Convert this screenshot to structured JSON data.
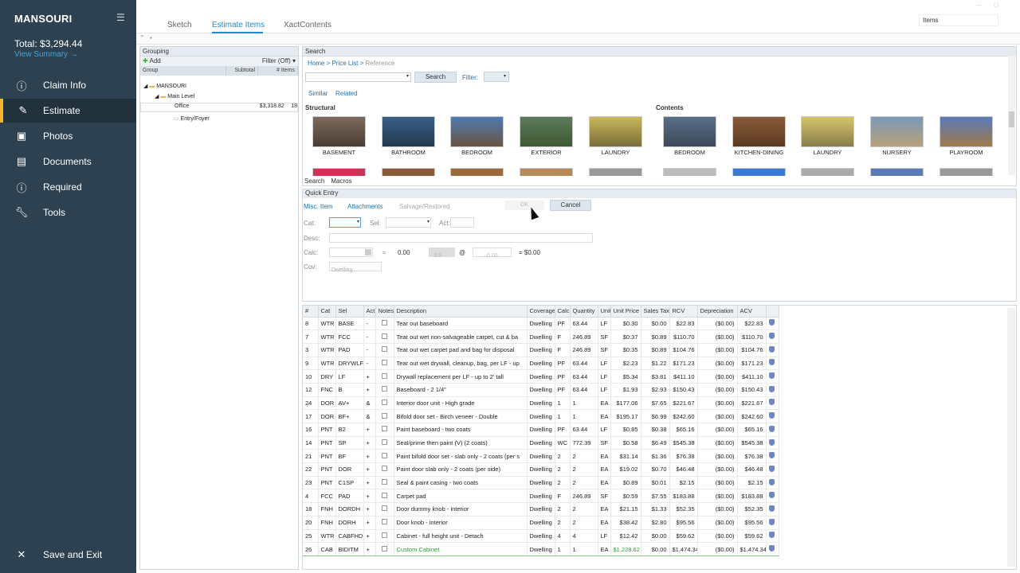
{
  "sidebar": {
    "project": "MANSOURI",
    "total": "Total: $3,294.44",
    "view_summary": "View Summary →",
    "items": [
      {
        "label": "Claim Info",
        "icon": "info-icon"
      },
      {
        "label": "Estimate",
        "icon": "pencil-icon"
      },
      {
        "label": "Photos",
        "icon": "photo-icon"
      },
      {
        "label": "Documents",
        "icon": "document-icon"
      },
      {
        "label": "Required",
        "icon": "info-icon"
      },
      {
        "label": "Tools",
        "icon": "wrench-icon"
      }
    ],
    "save_exit": "Save and Exit"
  },
  "tabs": [
    "Sketch",
    "Estimate Items",
    "XactContents"
  ],
  "items_dropdown": "Items",
  "grouping": {
    "title": "Grouping",
    "add": "Add",
    "filter": "Filter (Off)",
    "columns": [
      "Group",
      "Subtotal",
      "# Items"
    ],
    "tree": {
      "root": "MANSOURI",
      "level": "Main Level",
      "office": "Office",
      "office_subtotal": "$3,318.82",
      "office_count": "18",
      "entry": "Entry/Foyer"
    }
  },
  "search": {
    "title": "Search",
    "crumbs": [
      "Home",
      "Price List",
      "Reference"
    ],
    "button": "Search",
    "filter_label": "Filter:",
    "similar": "Similar",
    "related": "Related",
    "structural_label": "Structural",
    "contents_label": "Contents",
    "structural": [
      "BASEMENT",
      "BATHROOM",
      "BEDROOM",
      "EXTERIOR",
      "LAUNDRY"
    ],
    "contents": [
      "BEDROOM",
      "KITCHEN-DINING",
      "LAUNDRY",
      "NURSERY",
      "PLAYROOM"
    ],
    "bottom_tabs": [
      "Search",
      "Macros"
    ]
  },
  "quick_entry": {
    "title": "Quick Entry",
    "misc": "Misc. Item",
    "attachments": "Attachments",
    "salvage": "Salvage/Restored",
    "ok": "OK",
    "cancel": "Cancel",
    "cat": "Cat:",
    "sel": "Sel:",
    "act": "Act:",
    "desc": "Desc:",
    "calc": "Calc:",
    "eq": "=",
    "qty": "0.00",
    "unit": "EA",
    "at": "@",
    "price": "0.00",
    "total": "= $0.00",
    "cov": "Cov:",
    "cov_value": "Dwelling"
  },
  "grid": {
    "columns": [
      "#",
      "Cat",
      "Sel",
      "Act",
      "Notes",
      "Description",
      "Coverage",
      "Calc",
      "Quantity",
      "Unit",
      "Unit Price",
      "Sales Tax",
      "RCV",
      "Depreciation",
      "ACV"
    ],
    "rows": [
      [
        "8",
        "WTR",
        "BASE",
        "-",
        "Tear out baseboard",
        "Dwelling",
        "PF",
        "63.44",
        "LF",
        "$0.30",
        "$0.00",
        "$22.83",
        "($0.00)",
        "$22.83"
      ],
      [
        "7",
        "WTR",
        "FCC",
        "-",
        "Tear out wet non-salvageable carpet, cut & ba",
        "Dwelling",
        "F",
        "246.89",
        "SF",
        "$0.37",
        "$0.89",
        "$110.70",
        "($0.00)",
        "$110.70"
      ],
      [
        "3",
        "WTR",
        "PAD",
        "-",
        "Tear out wet carpet pad and bag for disposal",
        "Dwelling",
        "F",
        "246.89",
        "SF",
        "$0.35",
        "$0.89",
        "$104.76",
        "($0.00)",
        "$104.76"
      ],
      [
        "9",
        "WTR",
        "DRYWLF",
        "-",
        "Tear out wet drywall, cleanup, bag, per LF - up",
        "Dwelling",
        "PF",
        "63.44",
        "LF",
        "$2.23",
        "$1.22",
        "$171.23",
        "($0.00)",
        "$171.23"
      ],
      [
        "10",
        "DRY",
        "LF",
        "+",
        "Drywall replacement per LF - up to 2' tall",
        "Dwelling",
        "PF",
        "63.44",
        "LF",
        "$5.34",
        "$3.81",
        "$411.10",
        "($0.00)",
        "$411.10"
      ],
      [
        "12",
        "FNC",
        "B",
        "+",
        "Baseboard - 2 1/4\"",
        "Dwelling",
        "PF",
        "63.44",
        "LF",
        "$1.93",
        "$2.93",
        "$150.43",
        "($0.00)",
        "$150.43"
      ],
      [
        "24",
        "DOR",
        "AV+",
        "&",
        "Interior door unit - High grade",
        "Dwelling",
        "1",
        "1",
        "EA",
        "$177.06",
        "$7.65",
        "$221.67",
        "($0.00)",
        "$221.67"
      ],
      [
        "17",
        "DOR",
        "BF+",
        "&",
        "Bifold door set - Birch veneer - Double",
        "Dwelling",
        "1",
        "1",
        "EA",
        "$195.17",
        "$6.99",
        "$242.60",
        "($0.00)",
        "$242.60"
      ],
      [
        "16",
        "PNT",
        "B2",
        "+",
        "Paint baseboard - two coats",
        "Dwelling",
        "PF",
        "63.44",
        "LF",
        "$0.85",
        "$0.38",
        "$65.16",
        "($0.00)",
        "$65.16"
      ],
      [
        "14",
        "PNT",
        "SP",
        "+",
        "Seal/prime then paint (V) (2 coats)",
        "Dwelling",
        "WC",
        "772.39",
        "SF",
        "$0.58",
        "$6.49",
        "$545.38",
        "($0.00)",
        "$545.38"
      ],
      [
        "21",
        "PNT",
        "BF",
        "+",
        "Paint bifold door set - slab only - 2 coats (per s",
        "Dwelling",
        "2",
        "2",
        "EA",
        "$31.14",
        "$1.36",
        "$76.38",
        "($0.00)",
        "$76.38"
      ],
      [
        "22",
        "PNT",
        "DOR",
        "+",
        "Paint door slab only - 2 coats (per side)",
        "Dwelling",
        "2",
        "2",
        "EA",
        "$19.02",
        "$0.70",
        "$46.48",
        "($0.00)",
        "$46.48"
      ],
      [
        "23",
        "PNT",
        "C1SP",
        "+",
        "Seal & paint casing - two coats",
        "Dwelling",
        "2",
        "2",
        "EA",
        "$0.89",
        "$0.01",
        "$2.15",
        "($0.00)",
        "$2.15"
      ],
      [
        "4",
        "FCC",
        "PAD",
        "+",
        "Carpet pad",
        "Dwelling",
        "F",
        "246.89",
        "SF",
        "$0.59",
        "$7.55",
        "$183.88",
        "($0.00)",
        "$183.88"
      ],
      [
        "18",
        "FNH",
        "DORDH",
        "+",
        "Door dummy knob - interior",
        "Dwelling",
        "2",
        "2",
        "EA",
        "$21.15",
        "$1.33",
        "$52.35",
        "($0.00)",
        "$52.35"
      ],
      [
        "20",
        "FNH",
        "DORH",
        "+",
        "Door knob - interior",
        "Dwelling",
        "2",
        "2",
        "EA",
        "$38.42",
        "$2.80",
        "$95.56",
        "($0.00)",
        "$95.56"
      ],
      [
        "25",
        "WTR",
        "CABFHD",
        "+",
        "Cabinet - full height unit - Detach",
        "Dwelling",
        "4",
        "4",
        "LF",
        "$12.42",
        "$0.00",
        "$59.62",
        "($0.00)",
        "$59.62"
      ],
      [
        "26",
        "CAB",
        "BIDITM",
        "+",
        "Custom Cabinet",
        "Dwelling",
        "1",
        "1",
        "EA",
        "$1,228.62",
        "$0.00",
        "$1,474.34",
        "($0.00)",
        "$1,474.34"
      ]
    ]
  }
}
